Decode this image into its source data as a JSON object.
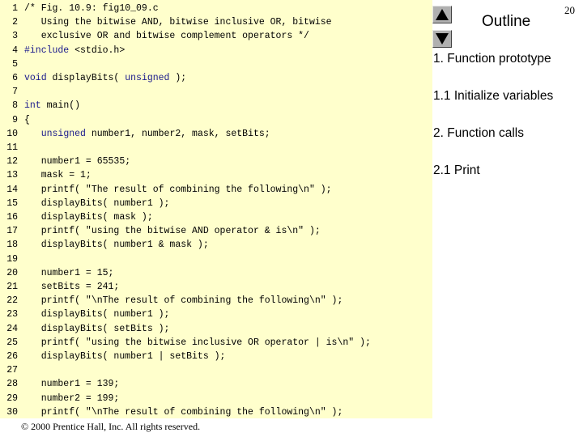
{
  "code_lines": [
    {
      "num": "1",
      "text": "/* Fig. 10.9: fig10_09.c"
    },
    {
      "num": "2",
      "text": "   Using the bitwise AND, bitwise inclusive OR, bitwise"
    },
    {
      "num": "3",
      "text": "   exclusive OR and bitwise complement operators */"
    },
    {
      "num": "4",
      "text": "#include <stdio.h>"
    },
    {
      "num": "5",
      "text": ""
    },
    {
      "num": "6",
      "text": "void displayBits( unsigned );"
    },
    {
      "num": "7",
      "text": ""
    },
    {
      "num": "8",
      "text": "int main()"
    },
    {
      "num": "9",
      "text": "{"
    },
    {
      "num": "10",
      "text": "   unsigned number1, number2, mask, setBits;"
    },
    {
      "num": "11",
      "text": ""
    },
    {
      "num": "12",
      "text": "   number1 = 65535;"
    },
    {
      "num": "13",
      "text": "   mask = 1;"
    },
    {
      "num": "14",
      "text": "   printf( \"The result of combining the following\\n\" );"
    },
    {
      "num": "15",
      "text": "   displayBits( number1 );"
    },
    {
      "num": "16",
      "text": "   displayBits( mask );"
    },
    {
      "num": "17",
      "text": "   printf( \"using the bitwise AND operator & is\\n\" );"
    },
    {
      "num": "18",
      "text": "   displayBits( number1 & mask );"
    },
    {
      "num": "19",
      "text": ""
    },
    {
      "num": "20",
      "text": "   number1 = 15;"
    },
    {
      "num": "21",
      "text": "   setBits = 241;"
    },
    {
      "num": "22",
      "text": "   printf( \"\\nThe result of combining the following\\n\" );"
    },
    {
      "num": "23",
      "text": "   displayBits( number1 );"
    },
    {
      "num": "24",
      "text": "   displayBits( setBits );"
    },
    {
      "num": "25",
      "text": "   printf( \"using the bitwise inclusive OR operator | is\\n\" );"
    },
    {
      "num": "26",
      "text": "   displayBits( number1 | setBits );"
    },
    {
      "num": "27",
      "text": ""
    },
    {
      "num": "28",
      "text": "   number1 = 139;"
    },
    {
      "num": "29",
      "text": "   number2 = 199;"
    },
    {
      "num": "30",
      "text": "   printf( \"\\nThe result of combining the following\\n\" );"
    }
  ],
  "footer": "© 2000 Prentice Hall, Inc.  All rights reserved.",
  "outline": {
    "title": "Outline",
    "items": [
      "1. Function prototype",
      "1.1 Initialize variables",
      "2. Function calls",
      "2.1 Print"
    ]
  },
  "page_number": "20",
  "icons": {
    "prev": "triangle-up-icon",
    "next": "triangle-down-icon"
  },
  "colors": {
    "code_background": "#ffffcc",
    "keyword": "#1a1a8c",
    "nav_button": "#b0b0b0"
  }
}
